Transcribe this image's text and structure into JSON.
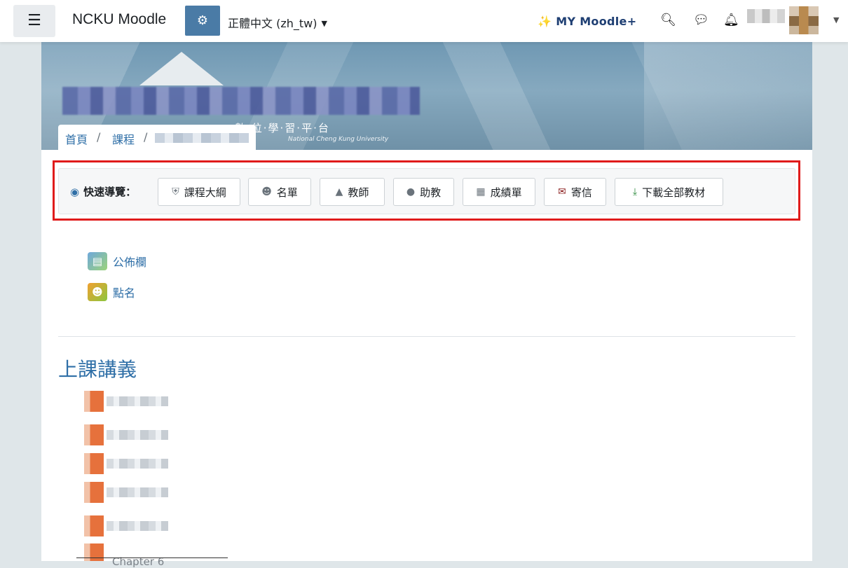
{
  "navbar": {
    "menu_icon": "hamburger-icon",
    "site_name": "NCKU Moodle",
    "settings_icon": "gears-icon",
    "language": "正體中文 (zh_tw)",
    "mymoodle": "MY Moodle+",
    "icons": [
      "sparkle-icon",
      "search-icon",
      "chat-icon",
      "bell-icon"
    ]
  },
  "banner": {
    "subtitle": "數·位·學·習·平·台",
    "subtitle_en": "National Cheng Kung University"
  },
  "breadcrumb": {
    "home": "首頁",
    "courses": "課程",
    "separator": "/"
  },
  "quicknav": {
    "label": "快速導覽：",
    "buttons": [
      {
        "label": "課程大綱",
        "icon": "shield-icon"
      },
      {
        "label": "名單",
        "icon": "users-icon"
      },
      {
        "label": "教師",
        "icon": "graduation-cap-icon"
      },
      {
        "label": "助教",
        "icon": "user-secret-icon"
      },
      {
        "label": "成績單",
        "icon": "table-icon"
      },
      {
        "label": "寄信",
        "icon": "envelope-icon"
      },
      {
        "label": "下載全部教材",
        "icon": "download-icon"
      }
    ]
  },
  "activities": [
    {
      "label": "公佈欄",
      "icon": "forum-icon"
    },
    {
      "label": "點名",
      "icon": "attendance-icon"
    }
  ],
  "section": {
    "title": "上課講義",
    "last_item": "Chapter 6"
  },
  "colors": {
    "accent": "#2f6fa7",
    "highlight": "#e01b1b",
    "brand_blue": "#1f3f73"
  }
}
